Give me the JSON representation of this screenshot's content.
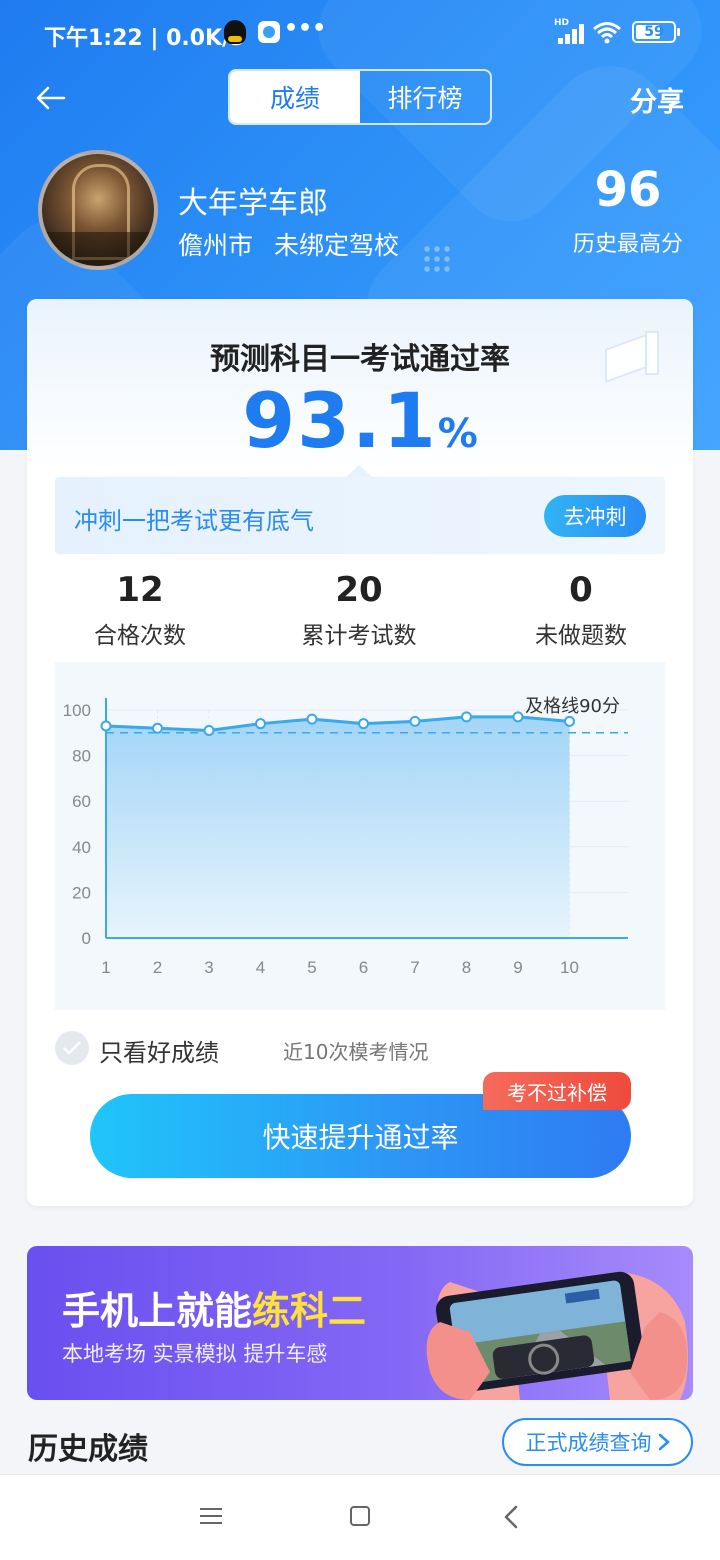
{
  "status_bar": {
    "time": "下午1:22 | 0.0K/s",
    "dots": "•••",
    "battery": "59",
    "hd": "HD"
  },
  "header": {
    "tabs": [
      "成绩",
      "排行榜"
    ],
    "share": "分享"
  },
  "profile": {
    "name": "大年学车郎",
    "city": "儋州市",
    "school": "未绑定驾校",
    "best_score": "96",
    "best_label": "历史最高分"
  },
  "prediction": {
    "title": "预测科目一考试通过率",
    "rate": "93.1",
    "unit": "%"
  },
  "sprint": {
    "text": "冲刺一把考试更有底气",
    "button": "去冲刺"
  },
  "stats": [
    {
      "value": "12",
      "label": "合格次数"
    },
    {
      "value": "20",
      "label": "累计考试数"
    },
    {
      "value": "0",
      "label": "未做题数"
    }
  ],
  "chart_data": {
    "type": "area",
    "x": [
      1,
      2,
      3,
      4,
      5,
      6,
      7,
      8,
      9,
      10
    ],
    "y": [
      93,
      92,
      91,
      94,
      96,
      94,
      95,
      97,
      97,
      95
    ],
    "ylim": [
      0,
      100
    ],
    "yticks": [
      0,
      20,
      40,
      60,
      80,
      100
    ],
    "pass_line": 90,
    "pass_line_label": "及格线90分",
    "colors": {
      "line": "#39a9ec",
      "fill_top": "#9fd3f6",
      "fill_bottom": "#e6f4fd",
      "pass_line": "#39a9ec"
    }
  },
  "filter": {
    "good_only": "只看好成绩",
    "recent": "近10次模考情况"
  },
  "boost": {
    "button": "快速提升通过率",
    "badge": "考不过补偿"
  },
  "banner": {
    "title_prefix": "手机上就能",
    "title_highlight": "练科二",
    "subtitle": "本地考场 实景模拟 提升车感"
  },
  "history": {
    "title": "历史成绩",
    "query_button": "正式成绩查询"
  }
}
